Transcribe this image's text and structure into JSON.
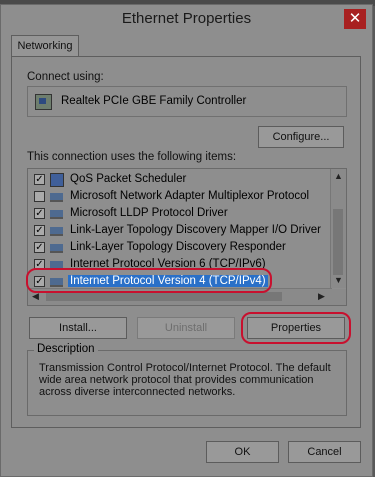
{
  "window": {
    "title": "Ethernet Properties",
    "close_glyph": "✕"
  },
  "tabs": [
    {
      "label": "Networking"
    }
  ],
  "connect": {
    "label": "Connect using:",
    "adapter": "Realtek PCIe GBE Family Controller",
    "configure_label": "Configure..."
  },
  "items": {
    "label": "This connection uses the following items:",
    "rows": [
      {
        "label": "QoS Packet Scheduler",
        "checked": true
      },
      {
        "label": "Microsoft Network Adapter Multiplexor Protocol",
        "checked": false
      },
      {
        "label": "Microsoft LLDP Protocol Driver",
        "checked": true
      },
      {
        "label": "Link-Layer Topology Discovery Mapper I/O Driver",
        "checked": true
      },
      {
        "label": "Link-Layer Topology Discovery Responder",
        "checked": true
      },
      {
        "label": "Internet Protocol Version 6 (TCP/IPv6)",
        "checked": true
      },
      {
        "label": "Internet Protocol Version 4 (TCP/IPv4)",
        "checked": true,
        "selected": true
      }
    ]
  },
  "buttons": {
    "install": "Install...",
    "uninstall": "Uninstall",
    "properties": "Properties",
    "ok": "OK",
    "cancel": "Cancel"
  },
  "description": {
    "label": "Description",
    "text": "Transmission Control Protocol/Internet Protocol. The default wide area network protocol that provides communication across diverse interconnected networks."
  },
  "highlight_color": "#c8102e",
  "selection_color": "#2a70c8"
}
